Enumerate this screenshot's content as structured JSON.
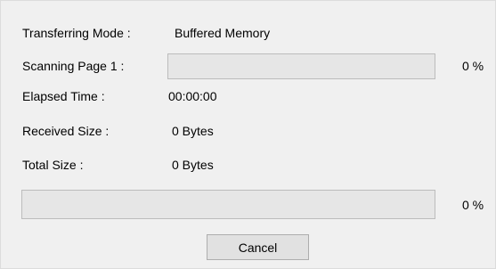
{
  "transfer_mode": {
    "label": "Transferring Mode :",
    "value": "Buffered Memory"
  },
  "scanning": {
    "label": "Scanning Page 1 :",
    "progress_fraction": 0,
    "percent_text": "0 %"
  },
  "elapsed_time": {
    "label": "Elapsed Time :",
    "value": "00:00:00"
  },
  "received_size": {
    "label": "Received Size :",
    "value": "0 Bytes"
  },
  "total_size": {
    "label": "Total Size :",
    "value": "0 Bytes"
  },
  "overall": {
    "progress_fraction": 0,
    "percent_text": "0 %"
  },
  "buttons": {
    "cancel_label": "Cancel"
  },
  "colors": {
    "background": "#f0f0f0",
    "progress_track": "#e6e6e6",
    "progress_fill": "#06b025"
  }
}
